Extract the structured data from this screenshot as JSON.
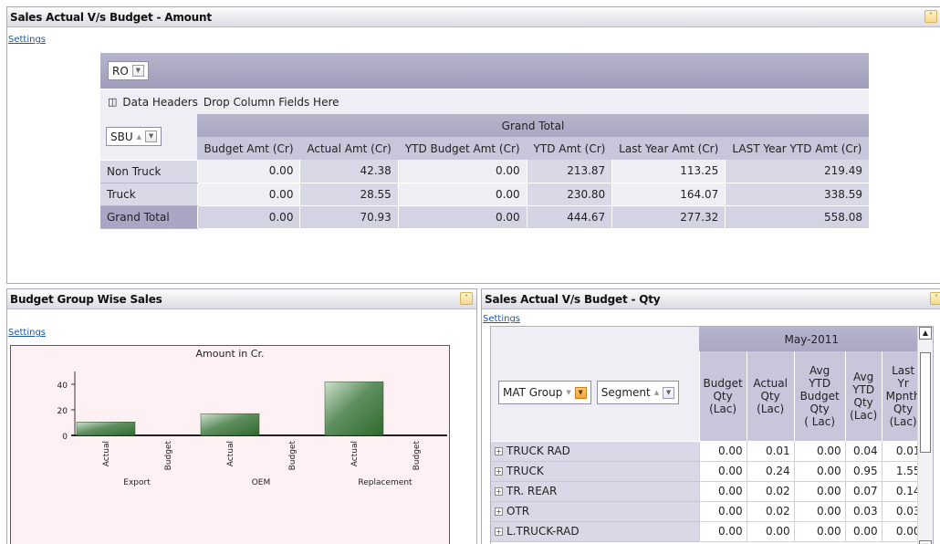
{
  "amount_panel": {
    "title": "Sales Actual V/s Budget - Amount",
    "settings": "Settings",
    "filter_label": "RO",
    "data_headers": "Data Headers",
    "drop_zone": "Drop Column Fields Here",
    "row_field": "SBU",
    "group_header": "Grand Total",
    "columns": [
      "Budget Amt (Cr)",
      "Actual Amt (Cr)",
      "YTD Budget Amt (Cr)",
      "YTD Amt (Cr)",
      "Last Year Amt (Cr)",
      "LAST Year YTD Amt (Cr)"
    ],
    "rows": [
      {
        "label": "Non Truck",
        "values": [
          "0.00",
          "42.38",
          "0.00",
          "213.87",
          "113.25",
          "219.49"
        ]
      },
      {
        "label": "Truck",
        "values": [
          "0.00",
          "28.55",
          "0.00",
          "230.80",
          "164.07",
          "338.59"
        ]
      }
    ],
    "grand_total": {
      "label": "Grand Total",
      "values": [
        "0.00",
        "70.93",
        "0.00",
        "444.67",
        "277.32",
        "558.08"
      ]
    }
  },
  "budget_panel": {
    "title": "Budget Group Wise Sales",
    "settings": "Settings"
  },
  "chart_data": {
    "type": "bar",
    "title": "Amount in Cr.",
    "groups": [
      "Export",
      "OEM",
      "Replacement"
    ],
    "categories": [
      "Actual",
      "Budget"
    ],
    "series": [
      {
        "name": "Actual",
        "values": [
          10.5,
          17,
          42
        ]
      },
      {
        "name": "Budget",
        "values": [
          0,
          0,
          0
        ]
      }
    ],
    "ylim": [
      0,
      50
    ],
    "yticks": [
      0,
      20,
      40
    ],
    "bar_color": "#2f6a2f"
  },
  "qty_panel": {
    "title": "Sales Actual V/s Budget - Qty",
    "settings": "Settings",
    "row_fields": [
      "MAT Group",
      "Segment"
    ],
    "month": "May-2011",
    "columns": [
      [
        "Budget",
        "Qty",
        "(Lac)"
      ],
      [
        "Actual",
        "Qty",
        "(Lac)"
      ],
      [
        "Avg",
        "YTD",
        "Budget",
        "Qty",
        "( Lac)"
      ],
      [
        "Avg",
        "YTD",
        "Qty",
        "(Lac)"
      ],
      [
        "Last",
        "Yr",
        "Mpnth",
        "Qty",
        "(Lac)"
      ]
    ],
    "rows": [
      {
        "label": "TRUCK RAD",
        "values": [
          "0.00",
          "0.01",
          "0.00",
          "0.04",
          "0.01"
        ]
      },
      {
        "label": "TRUCK",
        "values": [
          "0.00",
          "0.24",
          "0.00",
          "0.95",
          "1.55"
        ]
      },
      {
        "label": "TR. REAR",
        "values": [
          "0.00",
          "0.02",
          "0.00",
          "0.07",
          "0.14"
        ]
      },
      {
        "label": "OTR",
        "values": [
          "0.00",
          "0.02",
          "0.00",
          "0.03",
          "0.03"
        ]
      },
      {
        "label": "L.TRUCK-RAD",
        "values": [
          "0.00",
          "0.00",
          "0.00",
          "0.00",
          "0.00"
        ]
      }
    ]
  }
}
